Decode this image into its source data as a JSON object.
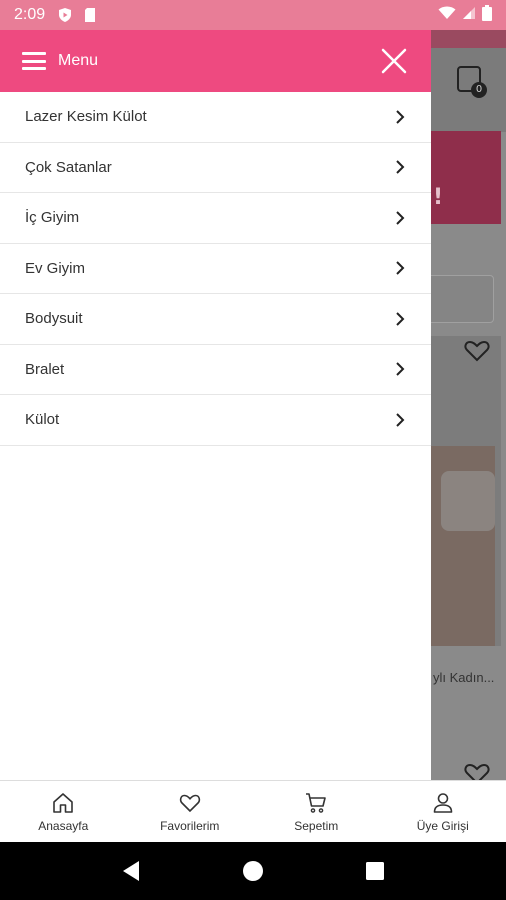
{
  "status_bar": {
    "time": "2:09",
    "icons": [
      "play-protect-icon",
      "sd-card-icon",
      "wifi-icon",
      "signal-icon",
      "battery-icon"
    ]
  },
  "colors": {
    "drawer_header": "#ee4a80",
    "status_bar": "#e87d97",
    "text": "#333333"
  },
  "drawer": {
    "title": "Menu",
    "items": [
      {
        "label": "Lazer Kesim Külot"
      },
      {
        "label": "Çok Satanlar"
      },
      {
        "label": "İç Giyim"
      },
      {
        "label": "Ev Giyim"
      },
      {
        "label": "Bodysuit"
      },
      {
        "label": "Bralet"
      },
      {
        "label": "Külot"
      }
    ]
  },
  "background": {
    "cart_count": "0",
    "banner_text": "!",
    "product_name": "ylı Kadın..."
  },
  "bottom_nav": {
    "items": [
      {
        "label": "Anasayfa",
        "icon": "home-icon"
      },
      {
        "label": "Favorilerim",
        "icon": "heart-icon"
      },
      {
        "label": "Sepetim",
        "icon": "cart-icon"
      },
      {
        "label": "Üye Girişi",
        "icon": "user-icon"
      }
    ]
  }
}
